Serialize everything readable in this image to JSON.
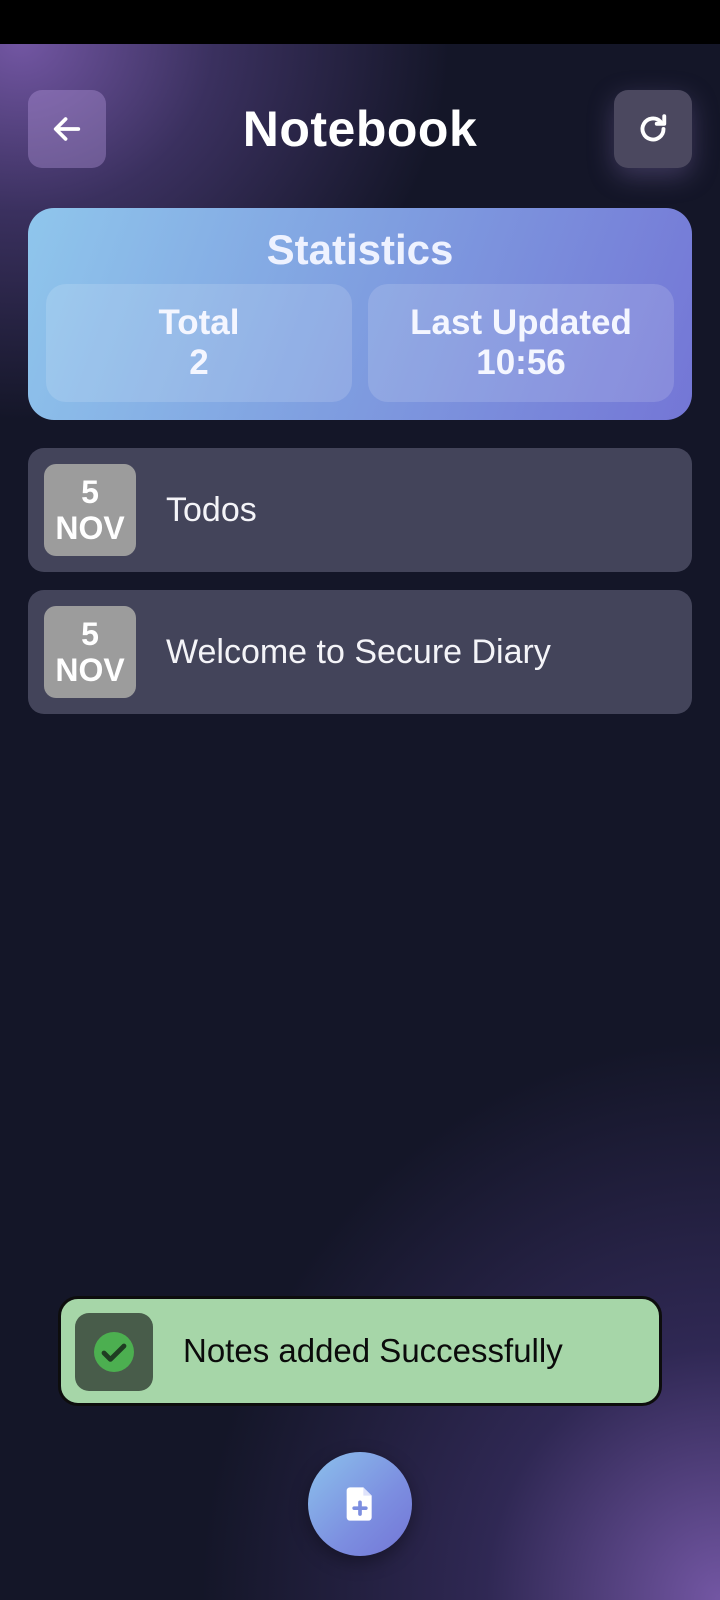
{
  "header": {
    "title": "Notebook",
    "back_icon": "arrow-left-icon",
    "refresh_icon": "refresh-icon"
  },
  "statistics": {
    "title": "Statistics",
    "total_label": "Total",
    "total_value": "2",
    "last_updated_label": "Last Updated",
    "last_updated_value": "10:56"
  },
  "notes": [
    {
      "day": "5",
      "month": "NOV",
      "title": "Todos"
    },
    {
      "day": "5",
      "month": "NOV",
      "title": "Welcome to Secure Diary"
    }
  ],
  "toast": {
    "message": "Notes added Successfully",
    "icon": "check-circle-icon",
    "color": "#a6d6a8"
  },
  "fab": {
    "icon": "add-note-icon"
  },
  "colors": {
    "background": "#141628",
    "accent_start": "#8fc6ec",
    "accent_end": "#7476d6",
    "note_card": "#43445a",
    "success": "#4caf50"
  }
}
